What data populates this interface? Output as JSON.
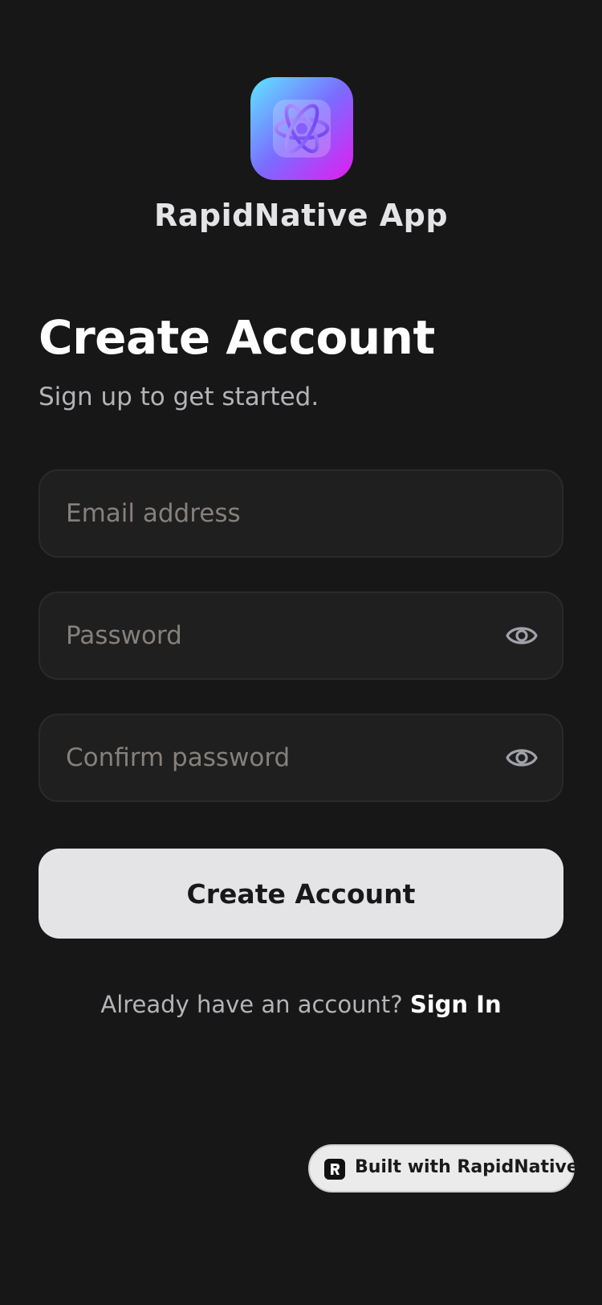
{
  "app": {
    "name": "RapidNative App",
    "logo_icon": "atom-icon",
    "logo_gradient": [
      "#5ee7ff",
      "#7a6cff",
      "#e21cf0"
    ]
  },
  "header": {
    "title": "Create Account",
    "subtitle": "Sign up to get started."
  },
  "form": {
    "email": {
      "placeholder": "Email address",
      "value": ""
    },
    "password": {
      "placeholder": "Password",
      "value": "",
      "toggle_icon": "eye-icon"
    },
    "confirm_password": {
      "placeholder": "Confirm password",
      "value": "",
      "toggle_icon": "eye-icon"
    },
    "submit_label": "Create Account"
  },
  "footer": {
    "prompt": "Already have an account?",
    "link_label": "Sign In"
  },
  "badge": {
    "label": "Built with RapidNative",
    "icon": "rapidnative-logo-icon"
  },
  "colors": {
    "background": "#171717",
    "field_background": "#1f1f1f",
    "field_border": "#2a2a2a",
    "button_background": "#e4e4e7",
    "button_text": "#18181b",
    "placeholder": "#85807c"
  }
}
